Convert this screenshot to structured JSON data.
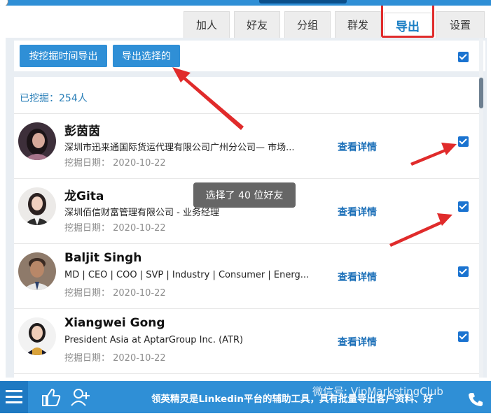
{
  "tabs": [
    {
      "label": "加人",
      "active": false
    },
    {
      "label": "好友",
      "active": false
    },
    {
      "label": "分组",
      "active": false
    },
    {
      "label": "群发",
      "active": false
    },
    {
      "label": "导出",
      "active": true
    },
    {
      "label": "设置",
      "active": false
    }
  ],
  "toolbar": {
    "export_by_time_label": "按挖掘时间导出",
    "export_selected_label": "导出选择的",
    "select_all_checked": true
  },
  "list": {
    "count_text": "已挖掘：254人",
    "detail_label": "查看详情",
    "contacts": [
      {
        "name": "彭茵茵",
        "description": "深圳市迅来通国际货运代理有限公司广州分公司— 市场...",
        "date": "挖掘日期：  2020-10-22",
        "checked": true
      },
      {
        "name": "龙Gita",
        "description": "深圳佰信财富管理有限公司 - 业务经理",
        "date": "挖掘日期：  2020-10-22",
        "checked": true
      },
      {
        "name": "Baljit Singh",
        "description": "MD | CEO | COO | SVP | Industry | Consumer | Energ...",
        "date": "挖掘日期：  2020-10-22",
        "checked": true
      },
      {
        "name": "Xiangwei Gong",
        "description": "President Asia at AptarGroup Inc. (ATR)",
        "date": "挖掘日期：  2020-10-22",
        "checked": true
      }
    ]
  },
  "tooltip": "选择了 40 位好友",
  "bottom_bar": {
    "ticker": "领英精灵是Linkedin平台的辅助工具，具有批量导出客户资料、好",
    "watermark": "微信号: VipMarketingClub"
  },
  "colors": {
    "accent": "#2f8fd6",
    "link": "#1b6fb8",
    "annotation_red": "#e02b2b",
    "checkbox": "#1a73d0"
  }
}
